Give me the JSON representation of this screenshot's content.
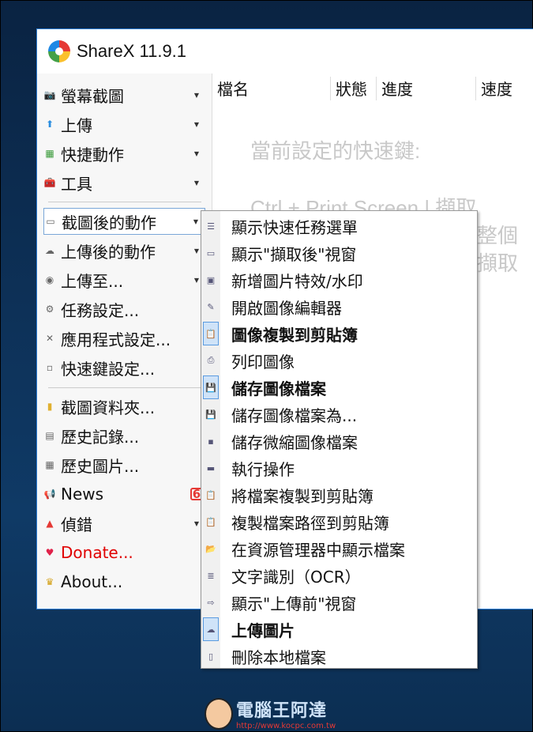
{
  "window": {
    "title": "ShareX 11.9.1"
  },
  "sidebar": {
    "items": [
      {
        "label": "螢幕截圖",
        "icon": "camera-icon",
        "arrow": true
      },
      {
        "label": "上傳",
        "icon": "upload-arrow-icon",
        "arrow": true
      },
      {
        "label": "快捷動作",
        "icon": "grid-icon",
        "arrow": true
      },
      {
        "label": "工具",
        "icon": "toolbox-icon",
        "arrow": true
      },
      {
        "label": "截圖後的動作",
        "icon": "image-actions-icon",
        "arrow": true,
        "selected": true
      },
      {
        "label": "上傳後的動作",
        "icon": "cloud-icon",
        "arrow": true
      },
      {
        "label": "上傳至...",
        "icon": "globe-icon",
        "arrow": true
      },
      {
        "label": "任務設定...",
        "icon": "gear-icon",
        "arrow": false
      },
      {
        "label": "應用程式設定...",
        "icon": "wrench-icon",
        "arrow": false
      },
      {
        "label": "快速鍵設定...",
        "icon": "keyboard-icon",
        "arrow": false
      },
      {
        "label": "截圖資料夾...",
        "icon": "folder-icon",
        "arrow": false
      },
      {
        "label": "歷史記錄...",
        "icon": "history-icon",
        "arrow": false
      },
      {
        "label": "歷史圖片...",
        "icon": "image-history-icon",
        "arrow": false
      },
      {
        "label": "News",
        "icon": "megaphone-icon",
        "arrow": false,
        "badge": "6"
      },
      {
        "label": "偵錯",
        "icon": "cone-icon",
        "arrow": true
      },
      {
        "label": "Donate...",
        "icon": "heart-icon",
        "arrow": false,
        "color": "#e00000"
      },
      {
        "label": "About...",
        "icon": "crown-icon",
        "arrow": false
      }
    ]
  },
  "list": {
    "columns": [
      "檔名",
      "狀態",
      "進度",
      "速度"
    ],
    "hotkeys_title": "當前設定的快速鍵:",
    "hotkey_lines": [
      "Ctrl + Print Screen  |  擷取",
      "整個",
      "擷取"
    ]
  },
  "menu": {
    "items": [
      {
        "label": "顯示快速任務選單",
        "icon": "menu-list-icon"
      },
      {
        "label": "顯示\"擷取後\"視窗",
        "icon": "window-icon"
      },
      {
        "label": "新增圖片特效/水印",
        "icon": "image-effects-icon"
      },
      {
        "label": "開啟圖像編輯器",
        "icon": "image-edit-icon"
      },
      {
        "label": "圖像複製到剪貼簿",
        "icon": "clipboard-icon",
        "checked": true
      },
      {
        "label": "列印圖像",
        "icon": "printer-icon"
      },
      {
        "label": "儲存圖像檔案",
        "icon": "floppy-icon",
        "checked": true
      },
      {
        "label": "儲存圖像檔案為...",
        "icon": "save-as-icon"
      },
      {
        "label": "儲存微縮圖像檔案",
        "icon": "floppy-small-icon"
      },
      {
        "label": "執行操作",
        "icon": "terminal-icon"
      },
      {
        "label": "將檔案複製到剪貼簿",
        "icon": "clipboard-file-icon"
      },
      {
        "label": "複製檔案路徑到剪貼簿",
        "icon": "clipboard-path-icon"
      },
      {
        "label": "在資源管理器中顯示檔案",
        "icon": "folder-open-icon"
      },
      {
        "label": "文字識別（OCR）",
        "icon": "ocr-icon"
      },
      {
        "label": "顯示\"上傳前\"視窗",
        "icon": "window-arrow-icon"
      },
      {
        "label": "上傳圖片",
        "icon": "cloud-upload-icon",
        "checked": true
      },
      {
        "label": "刪除本地檔案",
        "icon": "delete-file-icon"
      }
    ]
  },
  "watermark": {
    "text": "電腦王阿達",
    "url": "http://www.kocpc.com.tw"
  }
}
